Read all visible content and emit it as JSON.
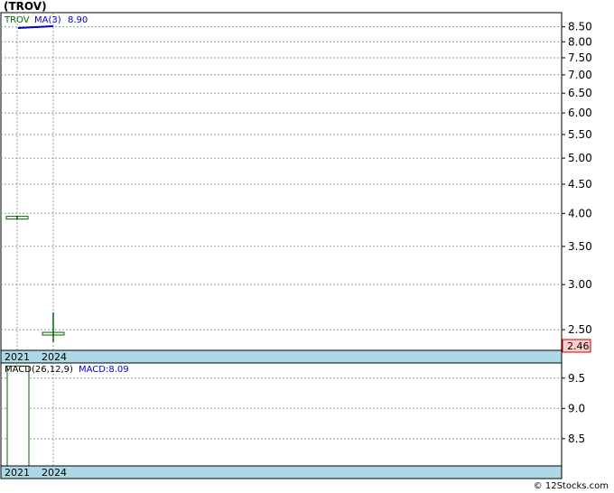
{
  "page": {
    "title": "(TROV)",
    "watermark": "© 12Stocks.com"
  },
  "chart_data": [
    {
      "type": "line",
      "subtype": "price",
      "legend": {
        "ticker": "TROV",
        "ma_label": "MA(3)",
        "ma_value": "8.90"
      },
      "x_labels": [
        "2021",
        "2024"
      ],
      "y_scale": "log",
      "ylim": [
        2.3,
        9.0
      ],
      "y_ticks": [
        "8.50",
        "8.00",
        "7.50",
        "7.00",
        "6.50",
        "6.00",
        "5.50",
        "5.00",
        "4.50",
        "4.00",
        "3.50",
        "3.00",
        "2.50"
      ],
      "y_tick_values": [
        8.5,
        8.0,
        7.5,
        7.0,
        6.5,
        6.0,
        5.5,
        5.0,
        4.5,
        4.0,
        3.5,
        3.0,
        2.5
      ],
      "bars": [
        {
          "label": "2021",
          "high": 3.96,
          "low": 3.9,
          "open": 3.93,
          "close": 3.93
        },
        {
          "label": "2024",
          "high": 2.68,
          "low": 2.38,
          "open": 2.46,
          "close": 2.46
        }
      ],
      "last_price_label": "2.46",
      "last_price": 2.46,
      "colors": {
        "bar": "#006400",
        "ma": "#0000cc",
        "band": "#add8e6",
        "last_price_bg": "#ffcccc"
      }
    },
    {
      "type": "bar",
      "subtype": "macd",
      "legend": {
        "name": "MACD(26,12,9)",
        "value_label": "MACD:8.09"
      },
      "x_labels": [
        "2021",
        "2024"
      ],
      "ylim": [
        8.05,
        9.75
      ],
      "y_ticks": [
        "9.5",
        "9.0",
        "8.5"
      ],
      "y_tick_values": [
        9.5,
        9.0,
        8.5
      ],
      "values": [
        9.7
      ]
    }
  ]
}
